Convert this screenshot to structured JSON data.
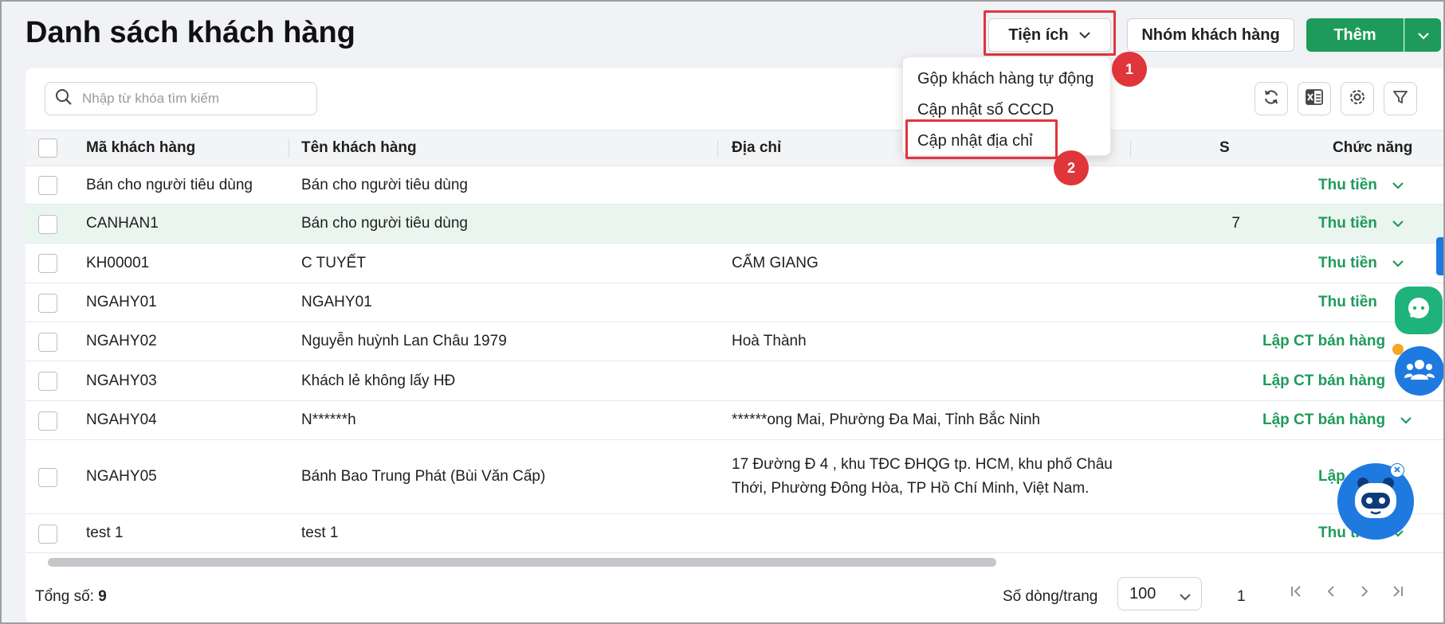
{
  "header": {
    "title": "Danh sách khách hàng",
    "utilities_label": "Tiện ích",
    "group_label": "Nhóm khách hàng",
    "add_label": "Thêm"
  },
  "search": {
    "placeholder": "Nhập từ khóa tìm kiếm"
  },
  "toolbar_icons": [
    "refresh-icon",
    "excel-icon",
    "gear-icon",
    "filter-icon"
  ],
  "table": {
    "columns": [
      "Mã khách hàng",
      "Tên khách hàng",
      "Địa chỉ",
      "S",
      "Chức năng"
    ],
    "rows": [
      {
        "code": "Bán cho người tiêu dùng",
        "name": "Bán cho người tiêu dùng",
        "address": "",
        "s": "",
        "action": "Thu tiền",
        "has_chevron": true
      },
      {
        "code": "CANHAN1",
        "name": "Bán cho người tiêu dùng",
        "address": "",
        "s": "7",
        "action": "Thu tiền",
        "has_chevron": true,
        "highlighted": true
      },
      {
        "code": "KH00001",
        "name": "C TUYẾT",
        "address": "CẨM GIANG",
        "s": "",
        "action": "Thu tiền",
        "has_chevron": true
      },
      {
        "code": "NGAHY01",
        "name": "NGAHY01",
        "address": "",
        "s": "",
        "action": "Thu tiền",
        "has_chevron": false
      },
      {
        "code": "NGAHY02",
        "name": "Nguyễn huỳnh Lan Châu 1979",
        "address": "Hoà Thành",
        "s": "",
        "action": "Lập CT bán hàng",
        "has_chevron": false
      },
      {
        "code": "NGAHY03",
        "name": "Khách lẻ không lấy HĐ",
        "address": "",
        "s": "",
        "action": "Lập CT bán hàng",
        "has_chevron": false
      },
      {
        "code": "NGAHY04",
        "name": "N******h",
        "address": "******ong Mai, Phường Đa Mai, Tỉnh Bắc Ninh",
        "s": "",
        "action": "Lập CT bán hàng",
        "has_chevron": true
      },
      {
        "code": "NGAHY05",
        "name": "Bánh Bao Trung Phát (Bùi Văn Cấp)",
        "address": "17 Đường Đ 4 , khu TĐC ĐHQG tp. HCM, khu phố Châu Thới, Phường Đông Hòa, TP Hồ Chí Minh, Việt Nam.",
        "s": "",
        "action": "Lập CT bán",
        "has_chevron": false
      },
      {
        "code": "test 1",
        "name": "test 1",
        "address": "",
        "s": "",
        "action": "Thu tiền",
        "has_chevron": true
      }
    ]
  },
  "footer": {
    "total_label": "Tổng số:",
    "total_value": "9",
    "rows_per_page_label": "Số dòng/trang",
    "rows_per_page_value": "100",
    "page": "1"
  },
  "utilities_menu": {
    "items": [
      "Gộp khách hàng tự động",
      "Cập nhật số CCCD",
      "Cập nhật địa chỉ"
    ]
  },
  "annotations": {
    "step1": "1",
    "step2": "2"
  },
  "colors": {
    "accent_green": "#1e9b5a",
    "highlight_red": "#e0353b",
    "brand_blue": "#1f7ae0"
  }
}
